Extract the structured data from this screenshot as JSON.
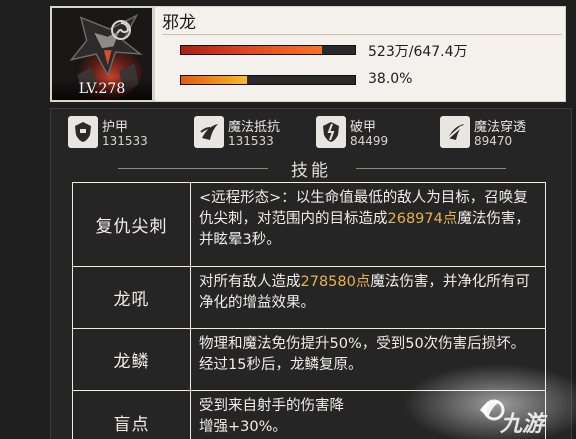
{
  "boss": {
    "name": "邪龙",
    "level": "LV.278",
    "faction_icon": "swirl-icon",
    "hp": {
      "text": "523万/647.4万",
      "fraction": 0.808
    },
    "rage": {
      "text": "38.0%",
      "fraction": 0.38
    }
  },
  "stats": [
    {
      "icon": "armor-icon",
      "label": "护甲",
      "value": "131533"
    },
    {
      "icon": "magic-resist-icon",
      "label": "魔法抵抗",
      "value": "131533"
    },
    {
      "icon": "armor-break-icon",
      "label": "破甲",
      "value": "84499"
    },
    {
      "icon": "magic-penetration-icon",
      "label": "魔法穿透",
      "value": "89470"
    }
  ],
  "skills_title": "技能",
  "skills": [
    {
      "name": "复仇尖刺",
      "desc_parts": [
        "<远程形态>：以生命值最低的敌人为目标，召唤复仇尖刺，对范围内的目标造成",
        "268974点",
        "魔法伤害，并眩晕3秒。"
      ]
    },
    {
      "name": "龙吼",
      "desc_parts": [
        "对所有敌人造成",
        "278580点",
        "魔法伤害，并净化所有可净化的增益效果。"
      ]
    },
    {
      "name": "龙鳞",
      "desc_parts": [
        "物理和魔法免伤提升50%，受到50次伤害后损坏。经过15秒后，龙鳞复原。"
      ]
    },
    {
      "name": "盲点",
      "desc_parts": [
        "受到来自射手的伤害降",
        "增强+30%。"
      ]
    }
  ],
  "watermark": "九游",
  "colors": {
    "highlight": "#e6b24c",
    "hp_bar": "#e04a1e",
    "rage_bar": "#f7bb2e"
  }
}
